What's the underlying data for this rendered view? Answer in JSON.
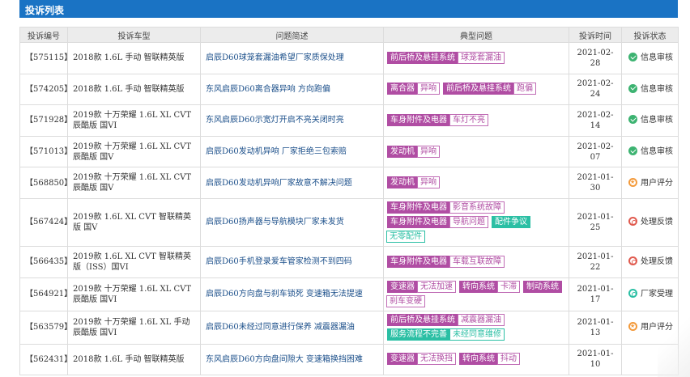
{
  "header": {
    "title": "投诉列表",
    "color": "#1a73c4"
  },
  "columns": [
    "投诉编号",
    "投诉车型",
    "问题简述",
    "典型问题",
    "投诉时间",
    "投诉状态"
  ],
  "rows": [
    {
      "id": "【575115】",
      "model": "2018款 1.6L 手动 智联精英版",
      "title": "启辰D60球笼套漏油希望厂家质保处理",
      "tags": [
        {
          "t": "前后桥及悬挂系统",
          "k": "cat"
        },
        {
          "t": "球笼套漏油",
          "k": "sub"
        }
      ],
      "time": "2021-02-28",
      "status": "信息审核",
      "status_icon": "check-circle-icon",
      "status_type": "green"
    },
    {
      "id": "【574205】",
      "model": "2018款 1.6L 手动 智联精英版",
      "title": "东风启辰D60离合器异响 方向跑偏",
      "tags": [
        {
          "t": "离合器",
          "k": "cat"
        },
        {
          "t": "异响",
          "k": "sub"
        },
        {
          "t": "前后桥及悬挂系统",
          "k": "cat"
        },
        {
          "t": "跑偏",
          "k": "sub"
        }
      ],
      "time": "2021-02-24",
      "status": "信息审核",
      "status_icon": "check-circle-icon",
      "status_type": "green"
    },
    {
      "id": "【571928】",
      "model": "2019款 十万荣耀 1.6L XL CVT 辰酷版 国VI",
      "title": "东风启辰D60示宽灯开启不亮关闭时亮",
      "tags": [
        {
          "t": "车身附件及电器",
          "k": "cat"
        },
        {
          "t": "车灯不亮",
          "k": "sub"
        }
      ],
      "time": "2021-02-14",
      "status": "信息审核",
      "status_icon": "check-circle-icon",
      "status_type": "green"
    },
    {
      "id": "【571013】",
      "model": "2019款 十万荣耀 1.6L XL CVT 辰酷版 国V",
      "title": "启辰D60发动机异响 厂家拒绝三包索赔",
      "tags": [
        {
          "t": "发动机",
          "k": "cat"
        },
        {
          "t": "异响",
          "k": "sub"
        }
      ],
      "time": "2021-02-07",
      "status": "信息审核",
      "status_icon": "check-circle-icon",
      "status_type": "green"
    },
    {
      "id": "【568850】",
      "model": "2019款 十万荣耀 1.6L XL CVT 辰酷版 国V",
      "title": "启辰D60发动机异响厂家故意不解决问题",
      "tags": [
        {
          "t": "发动机",
          "k": "cat"
        },
        {
          "t": "异响",
          "k": "sub"
        }
      ],
      "time": "2021-01-30",
      "status": "用户评分",
      "status_icon": "star-circle-icon",
      "status_type": "orange"
    },
    {
      "id": "【567424】",
      "model": "2019款 1.6L XL CVT 智联精英版 国V",
      "title": "启辰D60扬声器与导航模块厂家未发货",
      "tags": [
        {
          "t": "车身附件及电器",
          "k": "cat"
        },
        {
          "t": "影音系统故障",
          "k": "sub"
        },
        {
          "t": "车身附件及电器",
          "k": "cat"
        },
        {
          "t": "导航问题",
          "k": "sub"
        },
        {
          "t": "配件争议",
          "k": "tcat"
        },
        {
          "t": "无零配件",
          "k": "tsub"
        }
      ],
      "time": "2021-01-25",
      "status": "处理反馈",
      "status_icon": "feedback-circle-icon",
      "status_type": "red"
    },
    {
      "id": "【566435】",
      "model": "2019款 1.6L XL CVT 智联精英版（ISS）国VI",
      "title": "启辰D60手机登录爱车管家检测不到四码",
      "tags": [
        {
          "t": "车身附件及电器",
          "k": "cat"
        },
        {
          "t": "车载互联故障",
          "k": "sub"
        }
      ],
      "time": "2021-01-22",
      "status": "处理反馈",
      "status_icon": "feedback-circle-icon",
      "status_type": "red"
    },
    {
      "id": "【564921】",
      "model": "2019款 十万荣耀 1.6L XL CVT 辰酷版 国VI",
      "title": "启辰D60方向盘与刹车锁死 变速箱无法提速",
      "tags": [
        {
          "t": "变速器",
          "k": "cat"
        },
        {
          "t": "无法加速",
          "k": "sub"
        },
        {
          "t": "转向系统",
          "k": "cat"
        },
        {
          "t": "卡滞",
          "k": "sub"
        },
        {
          "t": "制动系统",
          "k": "cat"
        },
        {
          "t": "刹车变硬",
          "k": "sub"
        }
      ],
      "time": "2021-01-17",
      "status": "厂家受理",
      "status_icon": "accept-circle-icon",
      "status_type": "teal"
    },
    {
      "id": "【563579】",
      "model": "2019款 十万荣耀 1.6L XL 手动 辰酷版 国VI",
      "title": "启辰D60未经过同意进行保养 减震器漏油",
      "tags": [
        {
          "t": "前后桥及悬挂系统",
          "k": "cat"
        },
        {
          "t": "减震器漏油",
          "k": "sub"
        },
        {
          "t": "服务流程不完善",
          "k": "tcat"
        },
        {
          "t": "未经同意维修",
          "k": "tsub"
        }
      ],
      "time": "2021-01-13",
      "status": "用户评分",
      "status_icon": "star-circle-icon",
      "status_type": "orange"
    },
    {
      "id": "【562431】",
      "model": "2018款 1.6L 手动 智联精英版",
      "title": "东风启辰D60方向盘间隙大 变速箱换挡困难",
      "tags": [
        {
          "t": "变速器",
          "k": "cat"
        },
        {
          "t": "无法换挡",
          "k": "sub"
        },
        {
          "t": "转向系统",
          "k": "cat"
        },
        {
          "t": "抖动",
          "k": "sub"
        }
      ],
      "time": "2021-01-10",
      "status": "",
      "status_icon": "",
      "status_type": ""
    }
  ]
}
